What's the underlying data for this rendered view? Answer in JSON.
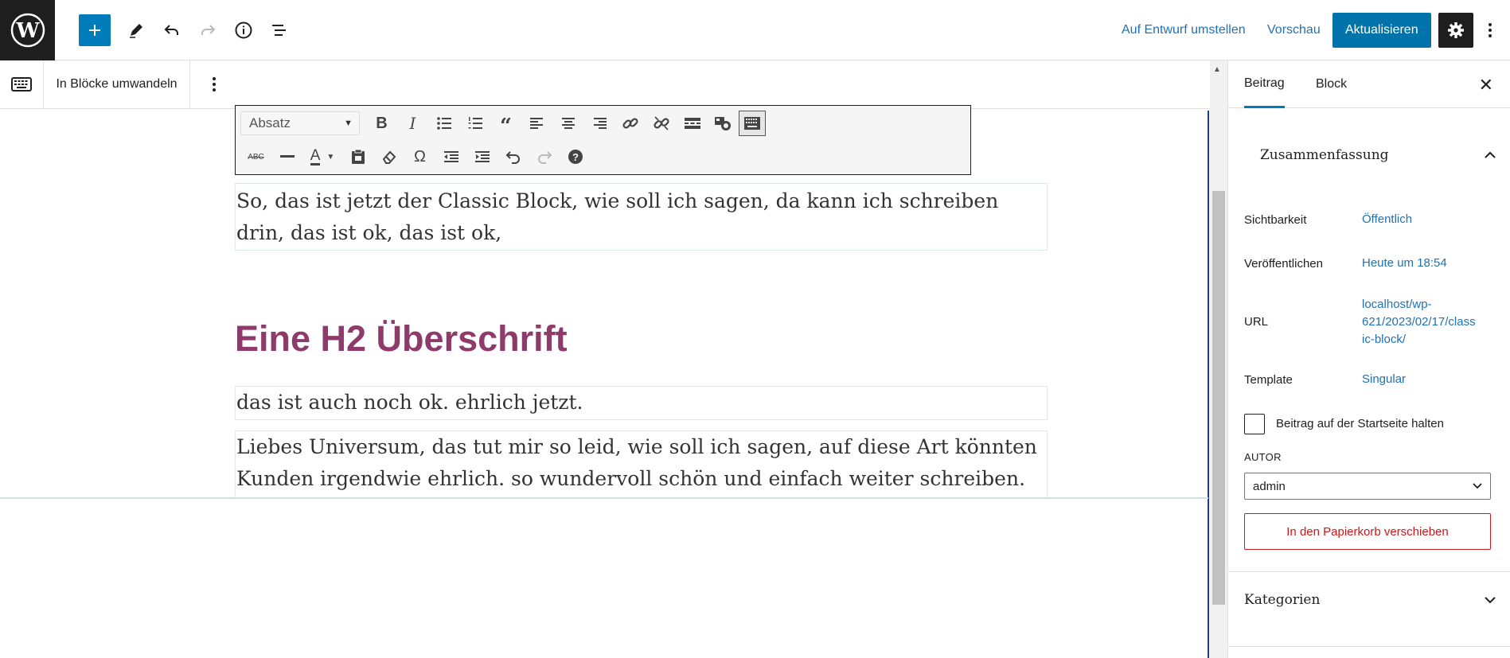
{
  "header": {
    "switch_to_draft": "Auf Entwurf umstellen",
    "preview": "Vorschau",
    "update": "Aktualisieren",
    "icons": [
      "wordpress-icon",
      "plus-icon",
      "pencil-icon",
      "undo-icon",
      "redo-icon",
      "info-icon",
      "list-view-icon",
      "gear-icon",
      "more-vertical-icon"
    ]
  },
  "block_toolbar": {
    "convert_label": "In Blöcke umwandeln"
  },
  "mce_toolbar": {
    "format_select": "Absatz"
  },
  "content": {
    "para1": "So, das ist jetzt der Classic Block, wie soll ich sagen, da kann ich schreiben drin, das ist ok, das ist ok,",
    "heading": "Eine H2 Überschrift",
    "para2": "das ist auch noch ok. ehrlich jetzt.",
    "para3": "Liebes Universum, das tut mir so leid, wie soll ich sagen, auf diese Art könnten Kunden irgendwie ehrlich. so wundervoll schön und einfach weiter schreiben."
  },
  "sidebar": {
    "tabs": [
      "Beitrag",
      "Block"
    ],
    "active_tab": "Beitrag",
    "summary_title": "Zusammenfassung",
    "rows": {
      "visibility_label": "Sichtbarkeit",
      "visibility_value": "Öffentlich",
      "publish_label": "Veröffentlichen",
      "publish_value": "Heute um 18:54",
      "url_label": "URL",
      "url_line1": "localhost/wp-",
      "url_line2": "621/2023/02/17/class",
      "url_line3": "ic-block/",
      "template_label": "Template",
      "template_value": "Singular"
    },
    "sticky_label": "Beitrag auf der Startseite halten",
    "author_label": "AUTOR",
    "author_value": "admin",
    "trash_label": "In den Papierkorb verschieben",
    "categories_title": "Kategorien"
  },
  "colors": {
    "accent": "#007cba",
    "heading": "#8e3a6b",
    "danger": "#cc1818",
    "link": "#2271b1"
  }
}
